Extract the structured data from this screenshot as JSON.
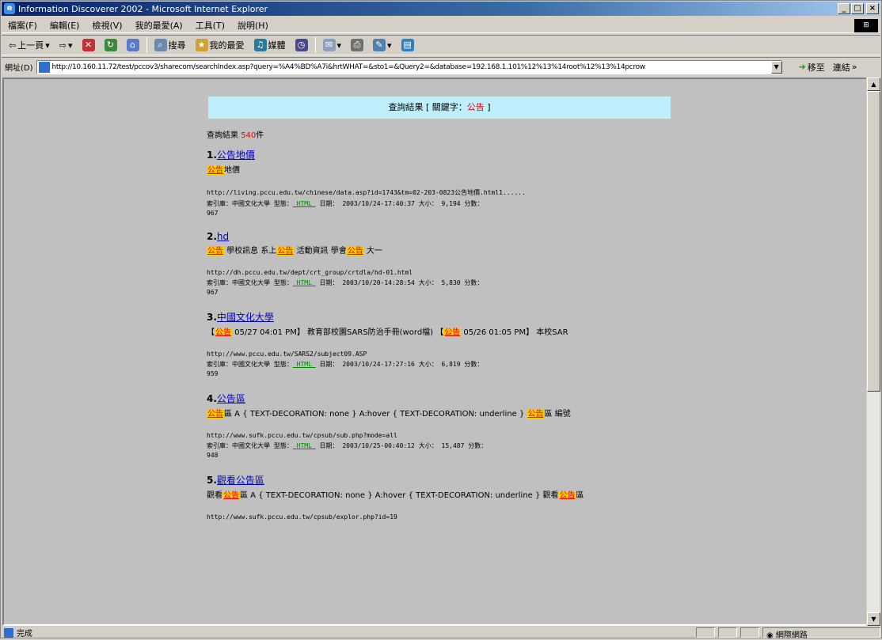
{
  "window": {
    "title": "Information Discoverer 2002 - Microsoft Internet Explorer",
    "min": "_",
    "max": "□",
    "close": "×"
  },
  "menu": [
    "檔案(F)",
    "編輯(E)",
    "檢視(V)",
    "我的最愛(A)",
    "工具(T)",
    "說明(H)"
  ],
  "toolbar": {
    "back": "上一頁",
    "forward": "",
    "search": "搜尋",
    "favorites": "我的最愛",
    "media": "媒體"
  },
  "address": {
    "label": "網址(D)",
    "url": "http://10.160.11.72/test/pccov3/sharecom/searchIndex.asp?query=%A4%BD%A7i&hrtWHAT=&sto1=&Query2=&database=192.168.1.101%12%13%14root%12%13%14pcrow",
    "go": "移至",
    "links": "連結"
  },
  "header": {
    "prefix": "查詢結果 [ 關鍵字：",
    "keyword": "公告",
    "suffix": " ]"
  },
  "count": {
    "label": "查詢結果",
    "num": "540",
    "unit": "件"
  },
  "results": [
    {
      "num": "1.",
      "title": "公告地價",
      "snip": [
        [
          "hl",
          "公告"
        ],
        [
          "t",
          "地價"
        ]
      ],
      "url": "http://living.pccu.edu.tw/chinese/data.asp?id=1743&tm=02-203-0823公告地價.html1......",
      "meta": "索引庫：中國文化大學  型態：",
      "type": "_HTML_",
      "date": "  日期： 2003/10/24-17:40:37   大小： 9,194   分數：",
      "score": "967"
    },
    {
      "num": "2.",
      "title": "hd",
      "snip": [
        [
          "hl",
          "公告"
        ],
        [
          "t",
          " 學校訊息 系上"
        ],
        [
          "hl",
          "公告"
        ],
        [
          "t",
          " 活動資訊 學會"
        ],
        [
          "hl",
          "公告"
        ],
        [
          "t",
          " 大一"
        ]
      ],
      "url": "http://dh.pccu.edu.tw/dept/crt_group/crtdla/hd-01.html",
      "meta": "索引庫：中國文化大學  型態：",
      "type": "_HTML_",
      "date": "  日期： 2003/10/20-14:28:54   大小： 5,830   分數：",
      "score": "967"
    },
    {
      "num": "3.",
      "title": "中國文化大學",
      "snip": [
        [
          "t",
          "【"
        ],
        [
          "hl",
          "公告"
        ],
        [
          "t",
          " 05/27 04:01 PM】 教育部校園SARS防治手冊(word檔) 【"
        ],
        [
          "hl",
          "公告"
        ],
        [
          "t",
          " 05/26 01:05 PM】 本校SAR"
        ]
      ],
      "url": "http://www.pccu.edu.tw/SARS2/subject09.ASP",
      "meta": "索引庫：中國文化大學  型態：",
      "type": "_HTML_",
      "date": "  日期： 2003/10/24-17:27:16   大小： 6,819   分數：",
      "score": "959"
    },
    {
      "num": "4.",
      "title": "公告區",
      "snip": [
        [
          "hl",
          "公告"
        ],
        [
          "t",
          "區 A { TEXT-DECORATION: none } A:hover { TEXT-DECORATION: underline } "
        ],
        [
          "hl",
          "公告"
        ],
        [
          "t",
          "區 編號"
        ]
      ],
      "url": "http://www.sufk.pccu.edu.tw/cpsub/sub.php?mode=all",
      "meta": "索引庫：中國文化大學  型態：",
      "type": "_HTML_",
      "date": "  日期： 2003/10/25-00:40:12   大小： 15,487   分數：",
      "score": "948"
    },
    {
      "num": "5.",
      "title": "觀看公告區",
      "snip": [
        [
          "t",
          "觀看"
        ],
        [
          "hl",
          "公告"
        ],
        [
          "t",
          "區 A { TEXT-DECORATION: none } A:hover { TEXT-DECORATION: underline } 觀看"
        ],
        [
          "hl",
          "公告"
        ],
        [
          "t",
          "區"
        ]
      ],
      "url": "http://www.sufk.pccu.edu.tw/cpsub/explor.php?id=19",
      "meta": "",
      "type": "",
      "date": "",
      "score": ""
    }
  ],
  "status": {
    "left": "完成",
    "zone": "網際網路"
  }
}
